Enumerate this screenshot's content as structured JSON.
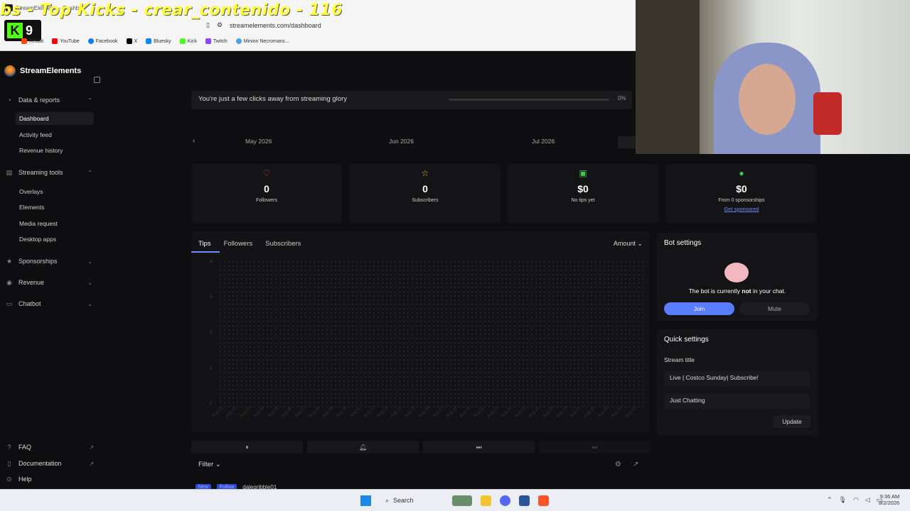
{
  "overlay": {
    "title": "bs - Top Kicks - crear_contenido - 116",
    "kick_count": "9"
  },
  "browser": {
    "tab": "StreamElements - Dashb...",
    "url": "streamelements.com/dashboard",
    "bookmarks": [
      "Reddit",
      "YouTube",
      "Facebook",
      "X",
      "Bluesky",
      "Kick",
      "Twitch",
      "Minion Necromanc..."
    ]
  },
  "sidebar": {
    "brand": "StreamElements",
    "sections": [
      {
        "label": "Data & reports",
        "items": [
          "Dashboard",
          "Activity feed",
          "Revenue history"
        ]
      },
      {
        "label": "Streaming tools",
        "items": [
          "Overlays",
          "Elements",
          "Media request",
          "Desktop apps"
        ]
      },
      {
        "label": "Sponsorships"
      },
      {
        "label": "Revenue"
      },
      {
        "label": "Chatbot"
      }
    ],
    "bottom": [
      "FAQ",
      "Documentation",
      "Help"
    ]
  },
  "banner": {
    "text": "You're just a few clicks away from streaming glory",
    "progress_pct": "0%",
    "progress_value": 0
  },
  "months": [
    "May 2026",
    "Jun 2026",
    "Jul 2026"
  ],
  "stats": [
    {
      "icon": "heart-icon",
      "value": "0",
      "label": "Followers",
      "color": "#e0405a"
    },
    {
      "icon": "star-icon",
      "value": "0",
      "label": "Subscribers",
      "color": "#f5b53a"
    },
    {
      "icon": "money-icon",
      "value": "$0",
      "label": "No tips yet",
      "color": "#3ec94a"
    },
    {
      "icon": "dollar-icon",
      "value": "$0",
      "label": "From 0 sponsorships",
      "link": "Get sponsored",
      "color": "#3ec94a"
    }
  ],
  "chart": {
    "tabs": [
      "Tips",
      "Followers",
      "Subscribers"
    ],
    "sort": "Amount",
    "y_ticks": [
      "4",
      "3",
      "2",
      "1",
      "0"
    ],
    "x_ticks": [
      "Aug 01",
      "Aug 02",
      "Aug 03",
      "Aug 04",
      "Aug 05",
      "Aug 06",
      "Aug 07",
      "Aug 08",
      "Aug 09",
      "Aug 10",
      "Aug 11",
      "Aug 12",
      "Aug 13",
      "Aug 14",
      "Aug 15",
      "Aug 16",
      "Aug 17",
      "Aug 18",
      "Aug 19",
      "Aug 20",
      "Aug 21",
      "Aug 22",
      "Aug 23",
      "Aug 24",
      "Aug 25",
      "Aug 26",
      "Aug 27",
      "Aug 28",
      "Aug 29",
      "Aug 30",
      "Aug 31"
    ]
  },
  "feed": {
    "filter": "Filter",
    "row": {
      "tag1": "New",
      "tag2": "Follow",
      "user": "dalegribble01"
    }
  },
  "bot": {
    "title": "Bot settings",
    "msg_pre": "The bot is currently ",
    "msg_bold": "not",
    "msg_post": " in your chat.",
    "join": "Join",
    "mute": "Mute"
  },
  "quick": {
    "title": "Quick settings",
    "stream_title_label": "Stream title",
    "stream_title": "Live | Costco Sunday| Subscribe!",
    "category": "Just Chatting",
    "update": "Update"
  },
  "taskbar": {
    "search": "Search",
    "time": "9:36 AM",
    "date": "8/2/2026"
  },
  "accent": "#5a7cff"
}
